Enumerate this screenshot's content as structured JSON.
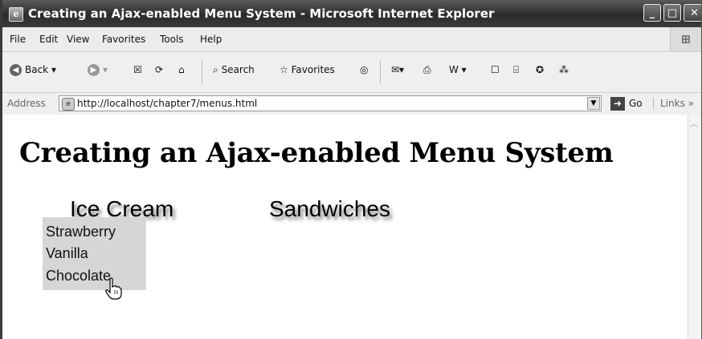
{
  "window": {
    "title": "Creating an Ajax-enabled Menu System - Microsoft Internet Explorer",
    "controls": {
      "minimize": "_",
      "maximize": "□",
      "close": "✕"
    }
  },
  "menubar": {
    "items": [
      "File",
      "Edit",
      "View",
      "Favorites",
      "Tools",
      "Help"
    ]
  },
  "toolbar": {
    "back_label": "Back",
    "search_label": "Search",
    "favorites_label": "Favorites"
  },
  "address": {
    "label": "Address",
    "url": "http://localhost/chapter7/menus.html",
    "go_label": "Go",
    "links_label": "Links"
  },
  "page": {
    "heading": "Creating an Ajax-enabled Menu System",
    "menus": [
      {
        "label": "Ice Cream",
        "items": [
          "Strawberry",
          "Vanilla",
          "Chocolate"
        ]
      },
      {
        "label": "Sandwiches"
      }
    ]
  },
  "icons": {
    "title_icon": "ie-page-icon",
    "cursor": "hand-pointer-icon"
  },
  "colors": {
    "titlebar": "#2b2b2b",
    "submenu_bg": "#d6d6d6"
  }
}
